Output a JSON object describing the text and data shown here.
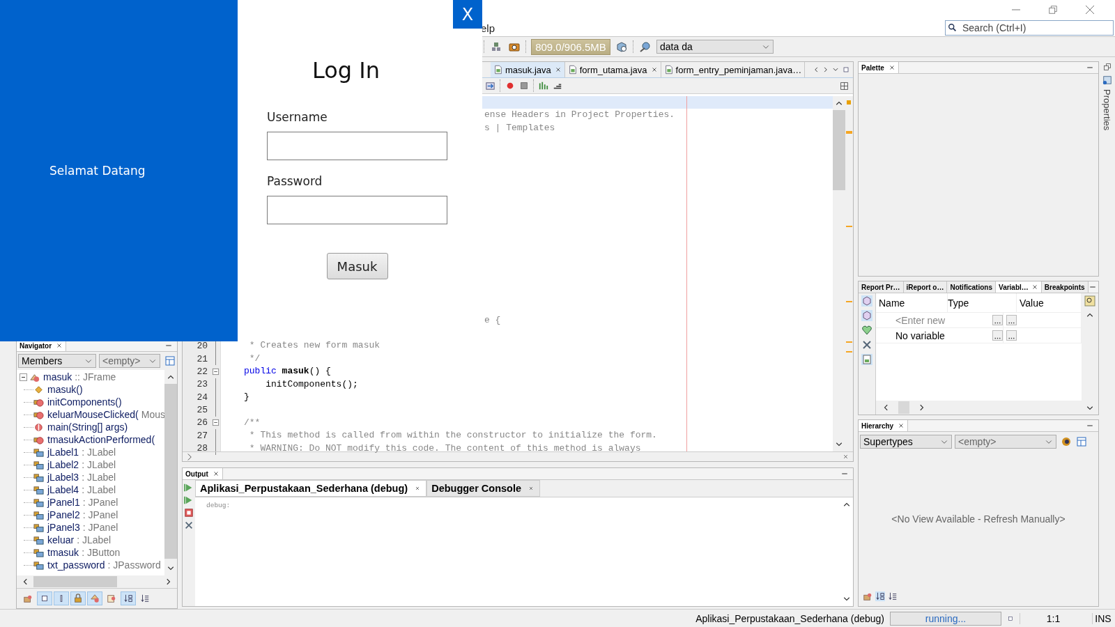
{
  "login_window": {
    "greeting": "Selamat Datang",
    "title": "Log In",
    "close_label": "X",
    "fields": [
      {
        "label": "Username"
      },
      {
        "label": "Password"
      }
    ],
    "submit_label": "Masuk"
  },
  "ide": {
    "menu_bar": [
      "elp"
    ],
    "search": {
      "placeholder": "Search (Ctrl+I)"
    },
    "toolbar": {
      "memory": "809.0/906.5MB",
      "configuration": "data da"
    },
    "editor": {
      "tabs": [
        {
          "label": "masuk.java",
          "selected": true,
          "closable": true
        },
        {
          "label": "form_utama.java",
          "selected": false,
          "closable": true
        },
        {
          "label": "form_entry_peminjaman.java…",
          "selected": false,
          "closable": false
        }
      ],
      "lines": [
        {
          "kind": "blank",
          "current": true
        },
        {
          "kind": "tail",
          "text": "ense Headers in Project Properties.",
          "current": false
        },
        {
          "kind": "tail",
          "text": "s | Templates",
          "current": false
        },
        {
          "kind": "blank",
          "current": false
        },
        {
          "kind": "blank",
          "current": false
        },
        {
          "kind": "blank",
          "current": false
        },
        {
          "kind": "blank",
          "current": false
        },
        {
          "kind": "blank",
          "current": false
        },
        {
          "kind": "blank",
          "current": false
        },
        {
          "kind": "blank",
          "current": false
        },
        {
          "kind": "blank",
          "current": false
        },
        {
          "kind": "blank",
          "current": false
        },
        {
          "kind": "blank",
          "current": false
        },
        {
          "kind": "blank",
          "current": false
        },
        {
          "kind": "blank",
          "current": false
        },
        {
          "kind": "blank",
          "current": false
        },
        {
          "kind": "blank",
          "current": false
        },
        {
          "kind": "tail",
          "text": "e {",
          "current": false
        },
        {
          "kind": "blank",
          "current": false
        },
        {
          "number": "20",
          "kind": "comment",
          "text": " * Creates new form masuk",
          "current": false,
          "fold": false
        },
        {
          "number": "21",
          "kind": "comment",
          "text": " */",
          "current": false,
          "fold": false
        },
        {
          "number": "22",
          "kind": "code",
          "keyword": "public",
          "text": "**masuk**() {",
          "current": false,
          "fold": true
        },
        {
          "number": "23",
          "kind": "code",
          "text": "    initComponents();",
          "current": false,
          "fold": false
        },
        {
          "number": "24",
          "kind": "code",
          "text": "}",
          "current": false,
          "fold": false
        },
        {
          "number": "25",
          "kind": "code",
          "current": false,
          "fold": false
        },
        {
          "number": "26",
          "kind": "comment",
          "text": "/**",
          "current": false,
          "fold": true
        },
        {
          "number": "27",
          "kind": "comment",
          "text": " * This method is called from within the constructor to initialize the form.",
          "current": false,
          "fold": false
        },
        {
          "number": "28",
          "kind": "comment",
          "text": " * WARNING: Do NOT modify this code. The content of this method is always",
          "current": false,
          "fold": false
        }
      ]
    },
    "navigator": {
      "title": "Navigator",
      "filter": "Members",
      "scope": "<empty>",
      "tree": {
        "name": "masuk",
        "type": ":: JFrame",
        "kind": "class",
        "expanded": true,
        "children": [
          {
            "name": "masuk()",
            "kind": "constructor"
          },
          {
            "name": "initComponents()",
            "kind": "method"
          },
          {
            "name": "keluarMouseClicked(",
            "type": "Mous",
            "kind": "method"
          },
          {
            "name": "main(String[] args)",
            "kind": "static"
          },
          {
            "name": "tmasukActionPerformed(",
            "kind": "method"
          },
          {
            "name": "jLabel1",
            "type": ": JLabel",
            "kind": "field"
          },
          {
            "name": "jLabel2",
            "type": ": JLabel",
            "kind": "field"
          },
          {
            "name": "jLabel3",
            "type": ": JLabel",
            "kind": "field"
          },
          {
            "name": "jLabel4",
            "type": ": JLabel",
            "kind": "field"
          },
          {
            "name": "jPanel1",
            "type": ": JPanel",
            "kind": "field"
          },
          {
            "name": "jPanel2",
            "type": ": JPanel",
            "kind": "field"
          },
          {
            "name": "jPanel3",
            "type": ": JPanel",
            "kind": "field"
          },
          {
            "name": "keluar",
            "type": ": JLabel",
            "kind": "field"
          },
          {
            "name": "tmasuk",
            "type": ": JButton",
            "kind": "field"
          },
          {
            "name": "txt_password",
            "type": ": JPassword",
            "kind": "field"
          }
        ]
      },
      "filters": [
        {
          "kind": "hierarchy",
          "on": false
        },
        {
          "kind": "fields",
          "on": true
        },
        {
          "kind": "static",
          "on": true
        },
        {
          "kind": "private",
          "on": true
        },
        {
          "kind": "inherited",
          "on": true
        },
        {
          "kind": "javadoc",
          "on": false
        },
        {
          "kind": "sort-type",
          "on": true
        },
        {
          "kind": "sort-source",
          "on": false
        }
      ]
    },
    "palette": {
      "title": "Palette"
    },
    "debug_panel": {
      "tabs": [
        {
          "label": "Report Pr…",
          "selected": false,
          "closable": false
        },
        {
          "label": "iReport o…",
          "selected": false,
          "closable": false
        },
        {
          "label": "Notifications",
          "selected": false,
          "closable": false
        },
        {
          "label": "Variabl…",
          "selected": true,
          "closable": true
        },
        {
          "label": "Breakpoints",
          "selected": false,
          "closable": false
        }
      ],
      "columns": [
        "Name",
        "Type",
        "Value"
      ],
      "rows": [
        {
          "name": "<Enter new",
          "kind": "placeholder"
        },
        {
          "name": "No variable",
          "kind": "message"
        }
      ]
    },
    "hierarchy": {
      "title": "Hierarchy",
      "mode": "Supertypes",
      "scope": "<empty>",
      "message": "<No View Available - Refresh Manually>"
    },
    "output": {
      "title": "Output",
      "tabs": [
        {
          "label": "Aplikasi_Perpustakaan_Sederhana (debug)",
          "selected": true
        },
        {
          "label": "Debugger Console",
          "selected": false
        }
      ],
      "lines": [
        "debug:"
      ]
    },
    "side_bar": {
      "tabs": [
        "Properties"
      ]
    },
    "status_bar": {
      "task": "Aplikasi_Perpustakaan_Sederhana (debug)",
      "progress": "running...",
      "position": "1:1",
      "mode": "INS"
    }
  }
}
